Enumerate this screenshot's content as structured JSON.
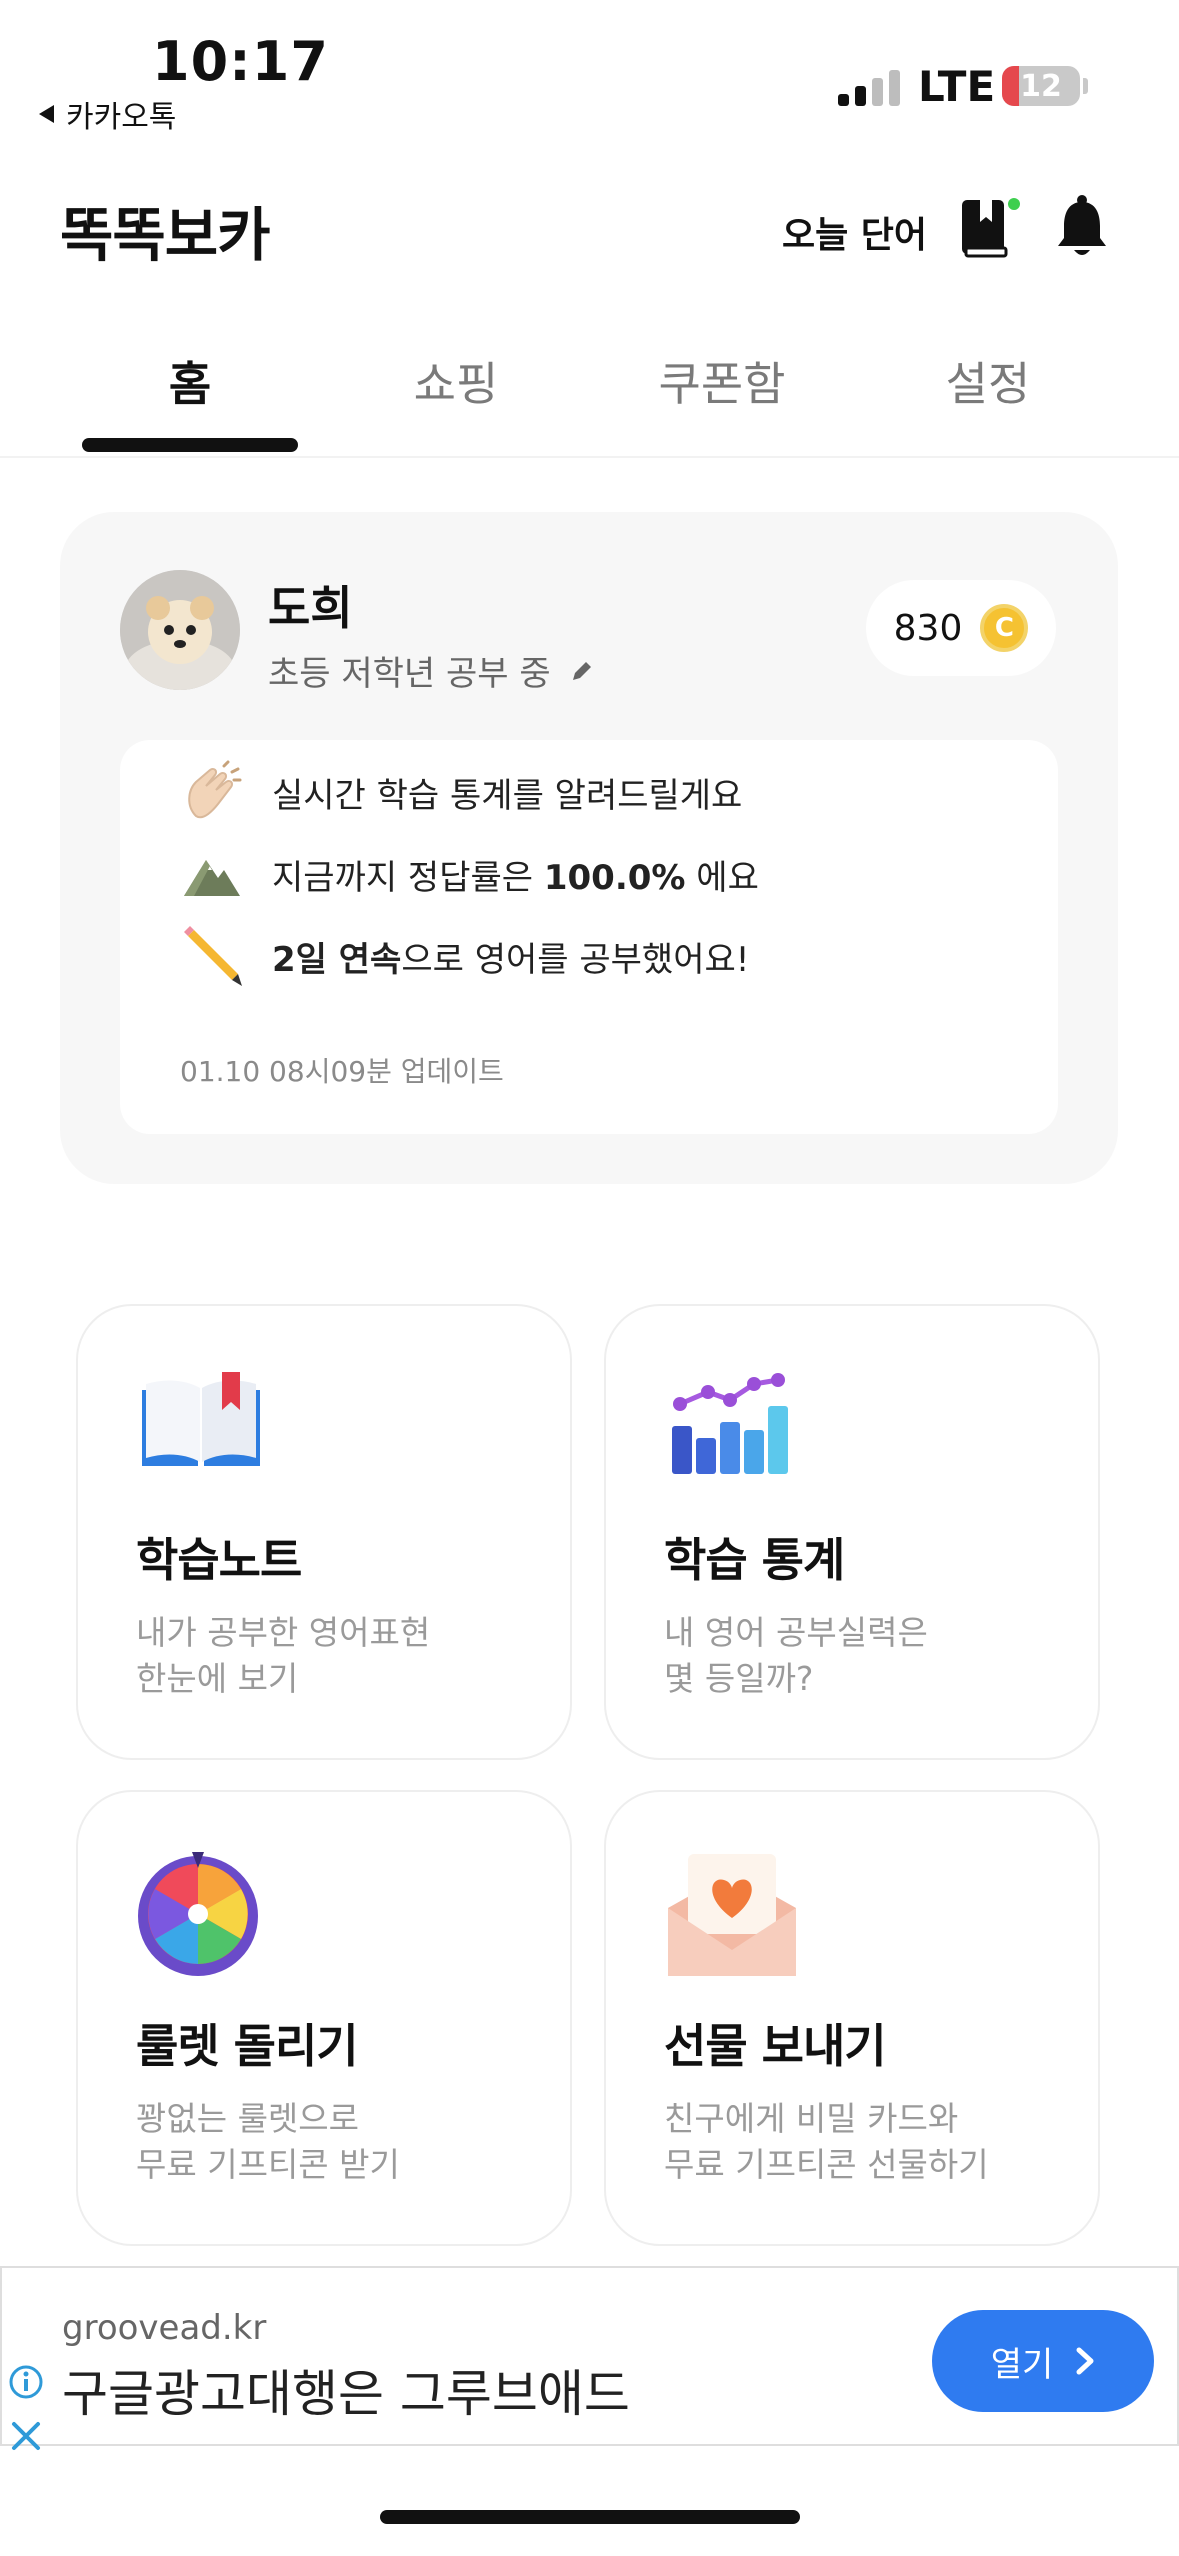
{
  "status_bar": {
    "time": "10:17",
    "back_app": "카카오톡",
    "network": "LTE",
    "battery": "12"
  },
  "header": {
    "title": "똑똑보카",
    "today_word": "오늘 단어"
  },
  "tabs": [
    {
      "label": "홈",
      "active": true
    },
    {
      "label": "쇼핑",
      "active": false
    },
    {
      "label": "쿠폰함",
      "active": false
    },
    {
      "label": "설정",
      "active": false
    }
  ],
  "profile": {
    "name": "도희",
    "status": "초등 저학년 공부 중",
    "coins": "830",
    "coin_symbol": "C"
  },
  "stats": {
    "line1": "실시간 학습 통계를 알려드릴게요",
    "line2_prefix": "지금까지 정답률은 ",
    "line2_value": "100.0%",
    "line2_suffix": " 에요",
    "line3_value": "2일 연속",
    "line3_suffix": "으로 영어를 공부했어요!",
    "updated": "01.10 08시09분 업데이트"
  },
  "features": [
    {
      "title": "학습노트",
      "desc1": "내가 공부한 영어표현",
      "desc2": "한눈에 보기",
      "icon": "book-icon"
    },
    {
      "title": "학습 통계",
      "desc1": "내 영어 공부실력은",
      "desc2": "몇 등일까?",
      "icon": "chart-icon"
    },
    {
      "title": "룰렛 돌리기",
      "desc1": "꽝없는 룰렛으로",
      "desc2": "무료 기프티콘 받기",
      "icon": "roulette-icon"
    },
    {
      "title": "선물 보내기",
      "desc1": "친구에게 비밀 카드와",
      "desc2": "무료 기프티콘 선물하기",
      "icon": "gift-envelope-icon"
    }
  ],
  "ad": {
    "domain": "groovead.kr",
    "headline": "구글광고대행은 그루브애드",
    "cta": "열기"
  },
  "colors": {
    "accent_blue": "#2f7bf0",
    "coin_gold": "#f5c232",
    "notify_green": "#3ecf4f"
  }
}
